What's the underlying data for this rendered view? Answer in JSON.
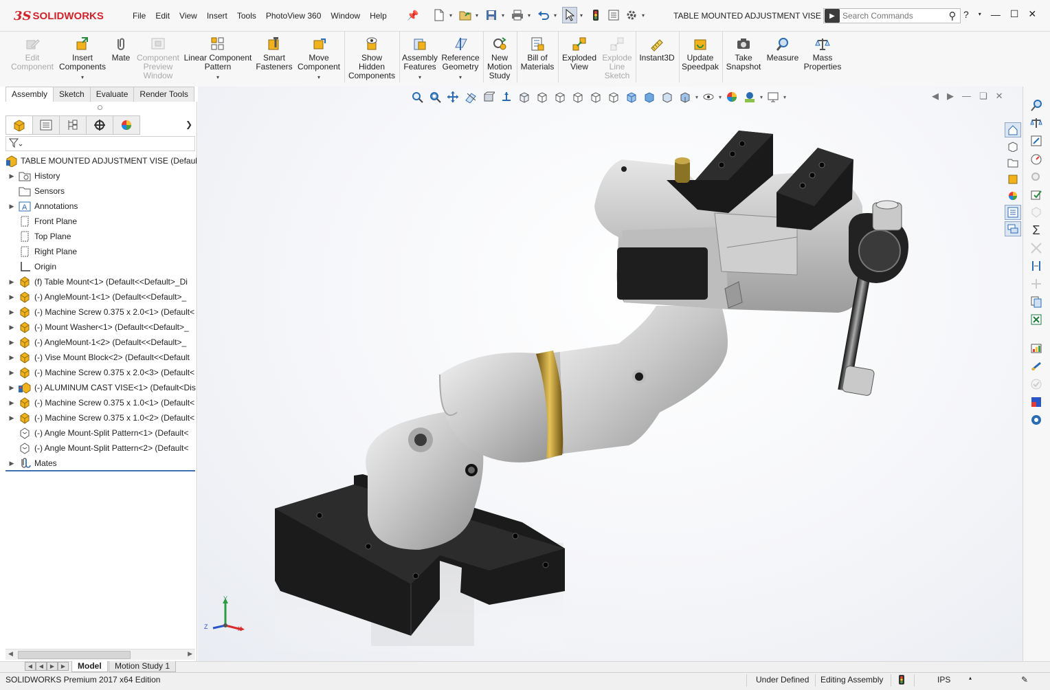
{
  "app": {
    "logo_ds": "3S",
    "logo_word": "SOLIDWORKS",
    "document_title": "TABLE MOUNTED ADJUSTMENT VISE *"
  },
  "menu": [
    "File",
    "Edit",
    "View",
    "Insert",
    "Tools",
    "PhotoView 360",
    "Window",
    "Help"
  ],
  "search": {
    "placeholder": "Search Commands"
  },
  "commands": {
    "edit_component": [
      "Edit",
      "Component"
    ],
    "insert_components": [
      "Insert",
      "Components"
    ],
    "mate": [
      "Mate"
    ],
    "component_preview": [
      "Component",
      "Preview",
      "Window"
    ],
    "linear_pattern": [
      "Linear Component",
      "Pattern"
    ],
    "smart_fasteners": [
      "Smart",
      "Fasteners"
    ],
    "move_component": [
      "Move",
      "Component"
    ],
    "show_hidden": [
      "Show",
      "Hidden",
      "Components"
    ],
    "assembly_features": [
      "Assembly",
      "Features"
    ],
    "reference_geometry": [
      "Reference",
      "Geometry"
    ],
    "new_motion": [
      "New",
      "Motion",
      "Study"
    ],
    "bom": [
      "Bill of",
      "Materials"
    ],
    "exploded_view": [
      "Exploded",
      "View"
    ],
    "explode_line": [
      "Explode",
      "Line",
      "Sketch"
    ],
    "instant3d": [
      "Instant3D"
    ],
    "update_speedpak": [
      "Update",
      "Speedpak"
    ],
    "take_snapshot": [
      "Take",
      "Snapshot"
    ],
    "measure": [
      "Measure"
    ],
    "mass_properties": [
      "Mass",
      "Properties"
    ]
  },
  "cm_tabs": [
    "Assembly",
    "Sketch",
    "Evaluate",
    "Render Tools"
  ],
  "tree": {
    "root": "TABLE MOUNTED ADJUSTMENT VISE  (Default<",
    "items": [
      {
        "label": "History",
        "expand": true,
        "icon": "history-icon"
      },
      {
        "label": "Sensors",
        "expand": false,
        "icon": "sensors-icon"
      },
      {
        "label": "Annotations",
        "expand": true,
        "icon": "annotations-icon"
      },
      {
        "label": "Front Plane",
        "expand": false,
        "icon": "plane-icon"
      },
      {
        "label": "Top Plane",
        "expand": false,
        "icon": "plane-icon"
      },
      {
        "label": "Right Plane",
        "expand": false,
        "icon": "plane-icon"
      },
      {
        "label": "Origin",
        "expand": false,
        "icon": "origin-icon"
      },
      {
        "label": "(f) Table Mount<1> (Default<<Default>_Di",
        "expand": true,
        "icon": "part-icon"
      },
      {
        "label": "(-) AngleMount-1<1> (Default<<Default>_",
        "expand": true,
        "icon": "part-icon"
      },
      {
        "label": "(-) Machine Screw 0.375 x 2.0<1> (Default<",
        "expand": true,
        "icon": "part-icon"
      },
      {
        "label": "(-) Mount Washer<1> (Default<<Default>_",
        "expand": true,
        "icon": "part-icon"
      },
      {
        "label": "(-) AngleMount-1<2> (Default<<Default>_",
        "expand": true,
        "icon": "part-icon"
      },
      {
        "label": "(-) Vise Mount Block<2> (Default<<Default",
        "expand": true,
        "icon": "part-icon"
      },
      {
        "label": "(-) Machine Screw 0.375 x 2.0<3> (Default<",
        "expand": true,
        "icon": "part-icon"
      },
      {
        "label": "(-) ALUMINUM CAST VISE<1> (Default<Dis",
        "expand": true,
        "icon": "subassembly-icon"
      },
      {
        "label": "(-) Machine Screw 0.375 x 1.0<1> (Default<",
        "expand": true,
        "icon": "part-icon"
      },
      {
        "label": "(-) Machine Screw 0.375 x 1.0<2> (Default<",
        "expand": true,
        "icon": "part-icon"
      },
      {
        "label": "(-) Angle Mount-Split Pattern<1> (Default<",
        "expand": false,
        "icon": "pattern-icon"
      },
      {
        "label": "(-) Angle Mount-Split Pattern<2> (Default<",
        "expand": false,
        "icon": "pattern-icon"
      },
      {
        "label": "Mates",
        "expand": true,
        "icon": "mates-icon"
      }
    ]
  },
  "triad": {
    "y": "Y",
    "x": "X",
    "z": "Z"
  },
  "bottom_tabs": {
    "model": "Model",
    "motion": "Motion Study 1"
  },
  "status": {
    "edition": "SOLIDWORKS Premium 2017 x64 Edition",
    "definition": "Under Defined",
    "mode": "Editing Assembly",
    "units": "IPS"
  },
  "colors": {
    "brand_red": "#d2232a",
    "part_yellow": "#f2b21b",
    "selection_blue": "#3f6fb5"
  }
}
